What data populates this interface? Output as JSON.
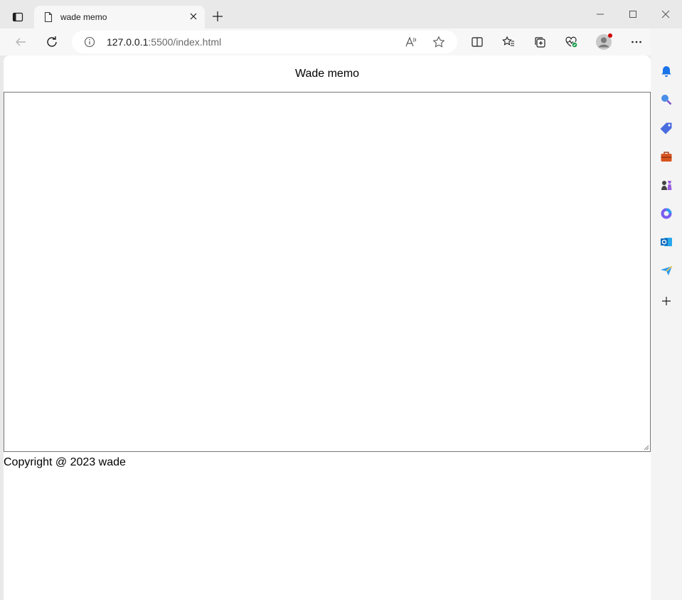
{
  "browser": {
    "tab": {
      "title": "wade memo"
    },
    "address": {
      "host": "127.0.0.1",
      "path": ":5500/index.html"
    }
  },
  "page": {
    "header_title": "Wade memo",
    "memo_value": "",
    "footer_text": "Copyright @ 2023 wade"
  },
  "colors": {
    "chrome_bg": "#e9e9e9",
    "toolbar_bg": "#f7f7f7",
    "sidebar_bg": "#f4f4f4",
    "accent_blue": "#1a73e8"
  },
  "icons": {
    "tab_actions": "tab-actions-icon",
    "tab_page": "page-icon",
    "tab_close": "close-icon",
    "new_tab": "plus-icon",
    "minimize": "minimize-icon",
    "maximize": "maximize-icon",
    "close_window": "close-icon",
    "back": "back-arrow-icon",
    "refresh": "refresh-icon",
    "site_info": "info-icon",
    "read_aloud": "read-aloud-icon",
    "favorite": "star-icon",
    "split_screen": "split-screen-icon",
    "favorites": "favorites-icon",
    "collections": "collections-icon",
    "browser_essentials": "heart-pulse-icon",
    "profile": "profile-avatar-icon",
    "more": "more-icon",
    "bing": "bing-copilot-icon",
    "sidebar": [
      "bell-icon",
      "search-icon",
      "tag-icon",
      "toolbox-icon",
      "games-icon",
      "copilot-icon",
      "outlook-icon",
      "send-icon",
      "add-icon"
    ]
  }
}
